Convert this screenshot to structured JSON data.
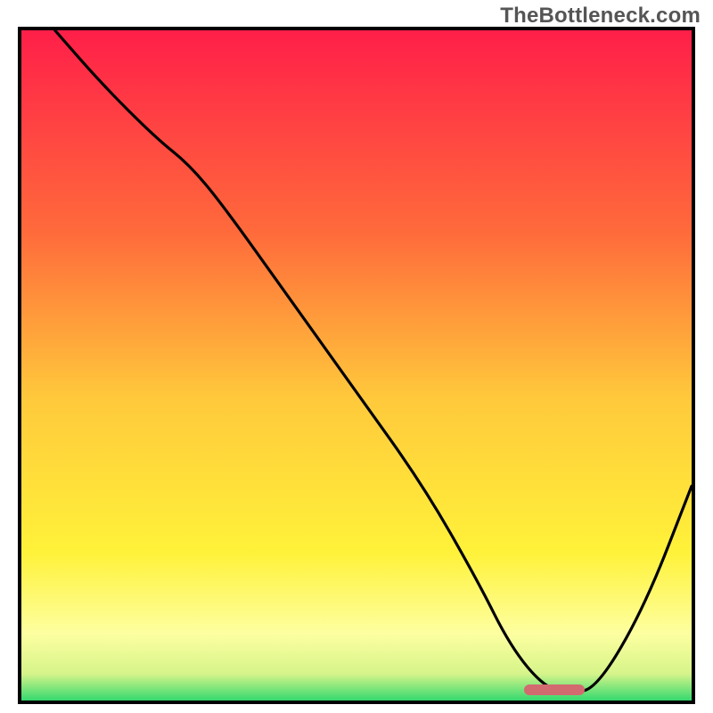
{
  "watermark": {
    "text": "TheBottleneck.com"
  },
  "chart_data": {
    "type": "line",
    "title": "",
    "xlabel": "",
    "ylabel": "",
    "x_range": [
      0,
      100
    ],
    "y_range": [
      0,
      100
    ],
    "gradient_stops": [
      {
        "pos": 0.0,
        "color": "#ff1f49"
      },
      {
        "pos": 0.3,
        "color": "#ff6a3b"
      },
      {
        "pos": 0.55,
        "color": "#ffc93b"
      },
      {
        "pos": 0.78,
        "color": "#fff23a"
      },
      {
        "pos": 0.9,
        "color": "#fdffa0"
      },
      {
        "pos": 0.96,
        "color": "#d6f48a"
      },
      {
        "pos": 1.0,
        "color": "#35d96f"
      }
    ],
    "series": [
      {
        "name": "bottleneck-curve",
        "x": [
          5,
          12,
          20,
          25,
          30,
          40,
          50,
          60,
          68,
          73,
          78,
          82,
          86,
          93,
          100
        ],
        "y": [
          100,
          92,
          84,
          80,
          74,
          60,
          46,
          32,
          18,
          8,
          2,
          1,
          2,
          14,
          32
        ]
      }
    ],
    "min_marker": {
      "x_start": 75,
      "x_end": 84,
      "y": 1.6
    }
  }
}
